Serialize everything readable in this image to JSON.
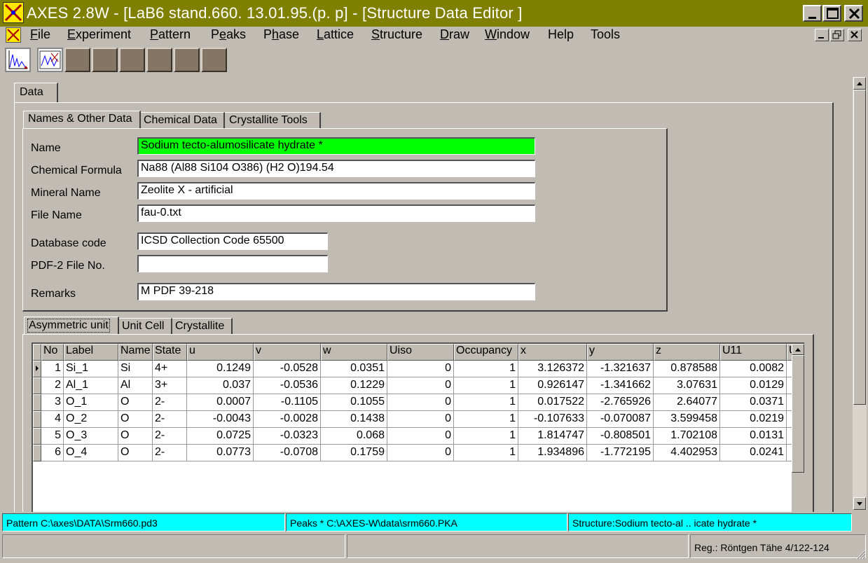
{
  "window": {
    "title": "AXES 2.8W - [LaB6 stand.660. 13.01.95.(p. p] - [Structure Data Editor ]"
  },
  "menu": [
    "File",
    "Experiment",
    "Pattern",
    "Peaks",
    "Phase",
    "Lattice",
    "Structure",
    "Draw",
    "Window",
    "Help",
    "Tools"
  ],
  "main_tabs": [
    "Data"
  ],
  "sub_tabs": [
    "Names & Other Data",
    "Chemical Data",
    "Crystallite Tools"
  ],
  "fields": {
    "name": {
      "label": "Name",
      "value": "Sodium tecto-alumosilicate hydrate *"
    },
    "chemical_formula": {
      "label": "Chemical Formula",
      "value": "Na88 (Al88 Si104 O386) (H2 O)194.54"
    },
    "mineral_name": {
      "label": "Mineral Name",
      "value": "Zeolite X - artificial"
    },
    "file_name": {
      "label": "File Name",
      "value": "fau-0.txt"
    },
    "database_code": {
      "label": "Database code",
      "value": "ICSD Collection Code 65500"
    },
    "pdf2_file_no": {
      "label": "PDF-2 File No.",
      "value": ""
    },
    "remarks": {
      "label": "Remarks",
      "value": "M PDF 39-218"
    }
  },
  "grid_tabs": [
    "Asymmetric unit",
    "Unit Cell",
    "Crystallite"
  ],
  "grid": {
    "columns": [
      "No",
      "Label",
      "Name",
      "State",
      "u",
      "v",
      "w",
      "Uiso",
      "Occupancy",
      "x",
      "y",
      "z",
      "U11",
      "U"
    ],
    "rows": [
      [
        "1",
        "Si_1",
        "Si",
        "4+",
        "0.1249",
        "-0.0528",
        "0.0351",
        "0",
        "1",
        "3.126372",
        "-1.321637",
        "0.878588",
        "0.0082"
      ],
      [
        "2",
        "Al_1",
        "Al",
        "3+",
        "0.037",
        "-0.0536",
        "0.1229",
        "0",
        "1",
        "0.926147",
        "-1.341662",
        "3.07631",
        "0.0129"
      ],
      [
        "3",
        "O_1",
        "O",
        "2-",
        "0.0007",
        "-0.1105",
        "0.1055",
        "0",
        "1",
        "0.017522",
        "-2.765926",
        "2.64077",
        "0.0371"
      ],
      [
        "4",
        "O_2",
        "O",
        "2-",
        "-0.0043",
        "-0.0028",
        "0.1438",
        "0",
        "1",
        "-0.107633",
        "-0.070087",
        "3.599458",
        "0.0219"
      ],
      [
        "5",
        "O_3",
        "O",
        "2-",
        "0.0725",
        "-0.0323",
        "0.068",
        "0",
        "1",
        "1.814747",
        "-0.808501",
        "1.702108",
        "0.0131"
      ],
      [
        "6",
        "O_4",
        "O",
        "2-",
        "0.0773",
        "-0.0708",
        "0.1759",
        "0",
        "1",
        "1.934896",
        "-1.772195",
        "4.402953",
        "0.0241"
      ]
    ]
  },
  "status": {
    "pattern": "Pattern  C:\\axes\\DATA\\Srm660.pd3",
    "peaks": "Peaks  *  C:\\AXES-W\\data\\srm660.PKA",
    "structure": "Structure:Sodium tecto-al .. icate hydrate *",
    "registration": "Reg.: Röntgen Tähe 4/122-124"
  },
  "colors": {
    "title_bar": "#808000",
    "highlight_field": "#00ff00",
    "status_cyan": "#00ffff",
    "toolbar_button": "#857565"
  }
}
